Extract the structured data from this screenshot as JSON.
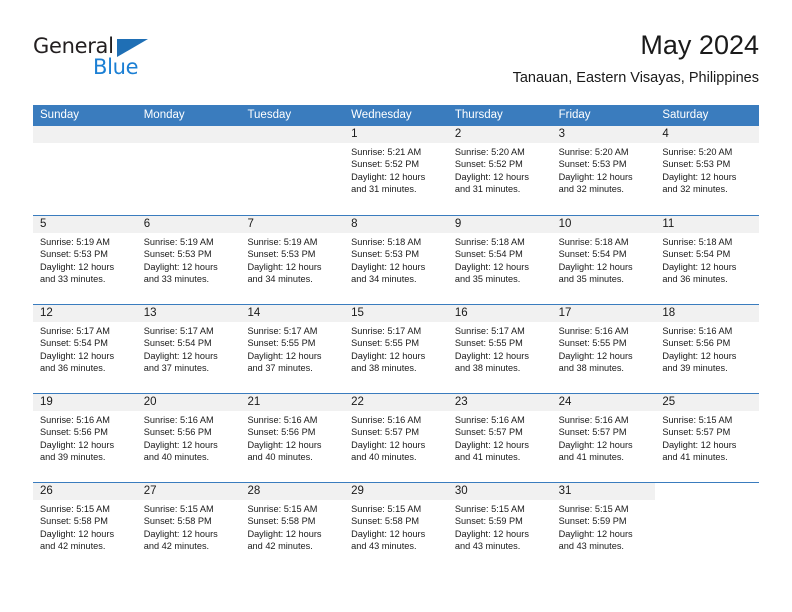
{
  "brand": {
    "name_part1": "General",
    "name_part2": "Blue",
    "triangle_color": "#1f6fb5",
    "blue_color": "#1b7fd4"
  },
  "header": {
    "title": "May 2024",
    "subtitle": "Tanauan, Eastern Visayas, Philippines"
  },
  "theme": {
    "header_row_bg": "#3a7cbe",
    "daynum_bg": "#f1f1f1",
    "text_color": "#1a1a1a"
  },
  "weekdays": [
    "Sunday",
    "Monday",
    "Tuesday",
    "Wednesday",
    "Thursday",
    "Friday",
    "Saturday"
  ],
  "weeks": [
    [
      {
        "day": "",
        "empty": true
      },
      {
        "day": "",
        "empty": true
      },
      {
        "day": "",
        "empty": true
      },
      {
        "day": "1",
        "sunrise": "Sunrise: 5:21 AM",
        "sunset": "Sunset: 5:52 PM",
        "daylight1": "Daylight: 12 hours",
        "daylight2": "and 31 minutes."
      },
      {
        "day": "2",
        "sunrise": "Sunrise: 5:20 AM",
        "sunset": "Sunset: 5:52 PM",
        "daylight1": "Daylight: 12 hours",
        "daylight2": "and 31 minutes."
      },
      {
        "day": "3",
        "sunrise": "Sunrise: 5:20 AM",
        "sunset": "Sunset: 5:53 PM",
        "daylight1": "Daylight: 12 hours",
        "daylight2": "and 32 minutes."
      },
      {
        "day": "4",
        "sunrise": "Sunrise: 5:20 AM",
        "sunset": "Sunset: 5:53 PM",
        "daylight1": "Daylight: 12 hours",
        "daylight2": "and 32 minutes."
      }
    ],
    [
      {
        "day": "5",
        "sunrise": "Sunrise: 5:19 AM",
        "sunset": "Sunset: 5:53 PM",
        "daylight1": "Daylight: 12 hours",
        "daylight2": "and 33 minutes."
      },
      {
        "day": "6",
        "sunrise": "Sunrise: 5:19 AM",
        "sunset": "Sunset: 5:53 PM",
        "daylight1": "Daylight: 12 hours",
        "daylight2": "and 33 minutes."
      },
      {
        "day": "7",
        "sunrise": "Sunrise: 5:19 AM",
        "sunset": "Sunset: 5:53 PM",
        "daylight1": "Daylight: 12 hours",
        "daylight2": "and 34 minutes."
      },
      {
        "day": "8",
        "sunrise": "Sunrise: 5:18 AM",
        "sunset": "Sunset: 5:53 PM",
        "daylight1": "Daylight: 12 hours",
        "daylight2": "and 34 minutes."
      },
      {
        "day": "9",
        "sunrise": "Sunrise: 5:18 AM",
        "sunset": "Sunset: 5:54 PM",
        "daylight1": "Daylight: 12 hours",
        "daylight2": "and 35 minutes."
      },
      {
        "day": "10",
        "sunrise": "Sunrise: 5:18 AM",
        "sunset": "Sunset: 5:54 PM",
        "daylight1": "Daylight: 12 hours",
        "daylight2": "and 35 minutes."
      },
      {
        "day": "11",
        "sunrise": "Sunrise: 5:18 AM",
        "sunset": "Sunset: 5:54 PM",
        "daylight1": "Daylight: 12 hours",
        "daylight2": "and 36 minutes."
      }
    ],
    [
      {
        "day": "12",
        "sunrise": "Sunrise: 5:17 AM",
        "sunset": "Sunset: 5:54 PM",
        "daylight1": "Daylight: 12 hours",
        "daylight2": "and 36 minutes."
      },
      {
        "day": "13",
        "sunrise": "Sunrise: 5:17 AM",
        "sunset": "Sunset: 5:54 PM",
        "daylight1": "Daylight: 12 hours",
        "daylight2": "and 37 minutes."
      },
      {
        "day": "14",
        "sunrise": "Sunrise: 5:17 AM",
        "sunset": "Sunset: 5:55 PM",
        "daylight1": "Daylight: 12 hours",
        "daylight2": "and 37 minutes."
      },
      {
        "day": "15",
        "sunrise": "Sunrise: 5:17 AM",
        "sunset": "Sunset: 5:55 PM",
        "daylight1": "Daylight: 12 hours",
        "daylight2": "and 38 minutes."
      },
      {
        "day": "16",
        "sunrise": "Sunrise: 5:17 AM",
        "sunset": "Sunset: 5:55 PM",
        "daylight1": "Daylight: 12 hours",
        "daylight2": "and 38 minutes."
      },
      {
        "day": "17",
        "sunrise": "Sunrise: 5:16 AM",
        "sunset": "Sunset: 5:55 PM",
        "daylight1": "Daylight: 12 hours",
        "daylight2": "and 38 minutes."
      },
      {
        "day": "18",
        "sunrise": "Sunrise: 5:16 AM",
        "sunset": "Sunset: 5:56 PM",
        "daylight1": "Daylight: 12 hours",
        "daylight2": "and 39 minutes."
      }
    ],
    [
      {
        "day": "19",
        "sunrise": "Sunrise: 5:16 AM",
        "sunset": "Sunset: 5:56 PM",
        "daylight1": "Daylight: 12 hours",
        "daylight2": "and 39 minutes."
      },
      {
        "day": "20",
        "sunrise": "Sunrise: 5:16 AM",
        "sunset": "Sunset: 5:56 PM",
        "daylight1": "Daylight: 12 hours",
        "daylight2": "and 40 minutes."
      },
      {
        "day": "21",
        "sunrise": "Sunrise: 5:16 AM",
        "sunset": "Sunset: 5:56 PM",
        "daylight1": "Daylight: 12 hours",
        "daylight2": "and 40 minutes."
      },
      {
        "day": "22",
        "sunrise": "Sunrise: 5:16 AM",
        "sunset": "Sunset: 5:57 PM",
        "daylight1": "Daylight: 12 hours",
        "daylight2": "and 40 minutes."
      },
      {
        "day": "23",
        "sunrise": "Sunrise: 5:16 AM",
        "sunset": "Sunset: 5:57 PM",
        "daylight1": "Daylight: 12 hours",
        "daylight2": "and 41 minutes."
      },
      {
        "day": "24",
        "sunrise": "Sunrise: 5:16 AM",
        "sunset": "Sunset: 5:57 PM",
        "daylight1": "Daylight: 12 hours",
        "daylight2": "and 41 minutes."
      },
      {
        "day": "25",
        "sunrise": "Sunrise: 5:15 AM",
        "sunset": "Sunset: 5:57 PM",
        "daylight1": "Daylight: 12 hours",
        "daylight2": "and 41 minutes."
      }
    ],
    [
      {
        "day": "26",
        "sunrise": "Sunrise: 5:15 AM",
        "sunset": "Sunset: 5:58 PM",
        "daylight1": "Daylight: 12 hours",
        "daylight2": "and 42 minutes."
      },
      {
        "day": "27",
        "sunrise": "Sunrise: 5:15 AM",
        "sunset": "Sunset: 5:58 PM",
        "daylight1": "Daylight: 12 hours",
        "daylight2": "and 42 minutes."
      },
      {
        "day": "28",
        "sunrise": "Sunrise: 5:15 AM",
        "sunset": "Sunset: 5:58 PM",
        "daylight1": "Daylight: 12 hours",
        "daylight2": "and 42 minutes."
      },
      {
        "day": "29",
        "sunrise": "Sunrise: 5:15 AM",
        "sunset": "Sunset: 5:58 PM",
        "daylight1": "Daylight: 12 hours",
        "daylight2": "and 43 minutes."
      },
      {
        "day": "30",
        "sunrise": "Sunrise: 5:15 AM",
        "sunset": "Sunset: 5:59 PM",
        "daylight1": "Daylight: 12 hours",
        "daylight2": "and 43 minutes."
      },
      {
        "day": "31",
        "sunrise": "Sunrise: 5:15 AM",
        "sunset": "Sunset: 5:59 PM",
        "daylight1": "Daylight: 12 hours",
        "daylight2": "and 43 minutes."
      },
      {
        "day": "",
        "empty": true,
        "no_band": true
      }
    ]
  ]
}
